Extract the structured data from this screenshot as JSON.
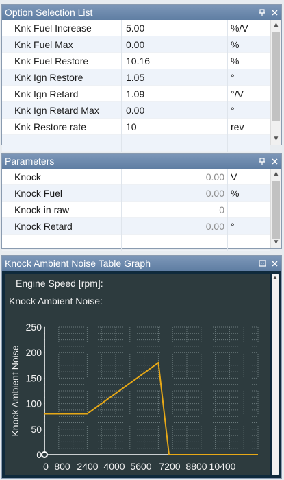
{
  "option_panel": {
    "title": "Option Selection List",
    "rows": [
      {
        "name": "Knk Fuel Increase",
        "value": "5.00",
        "unit": "%/V"
      },
      {
        "name": "Knk Fuel Max",
        "value": "0.00",
        "unit": "%"
      },
      {
        "name": "Knk Fuel Restore",
        "value": "10.16",
        "unit": "%"
      },
      {
        "name": "Knk Ign Restore",
        "value": "1.05",
        "unit": "°"
      },
      {
        "name": "Knk Ign Retard",
        "value": "1.09",
        "unit": "°/V"
      },
      {
        "name": "Knk Ign Retard Max",
        "value": "0.00",
        "unit": "°"
      },
      {
        "name": "Knk Restore rate",
        "value": "10",
        "unit": "rev"
      }
    ]
  },
  "params_panel": {
    "title": "Parameters",
    "rows": [
      {
        "name": "Knock",
        "value": "0.00",
        "unit": "V"
      },
      {
        "name": "Knock Fuel",
        "value": "0.00",
        "unit": "%"
      },
      {
        "name": "Knock in raw",
        "value": "0",
        "unit": ""
      },
      {
        "name": "Knock Retard",
        "value": "0.00",
        "unit": "°"
      }
    ]
  },
  "graph_panel": {
    "title": "Knock Ambient Noise Table Graph",
    "engine_speed_label": "Engine Speed [rpm]:",
    "noise_label": "Knock Ambient Noise:"
  },
  "icons": {
    "pin": "pin-icon",
    "close": "close-icon",
    "maximize": "maximize-icon"
  },
  "colors": {
    "title_bar": "#6f8db2",
    "graph_bg": "#2d3b3e",
    "line": "#e6a817",
    "grid": "#6b7a7c"
  },
  "chart_data": {
    "type": "line",
    "xlabel": "Engine Speed [rpm]",
    "ylabel": "Knock Ambient Noise",
    "xlim": [
      0,
      12000
    ],
    "ylim": [
      0,
      250
    ],
    "x_ticks": [
      "0",
      "800",
      "2400",
      "4000",
      "5600",
      "7200",
      "8800",
      "10400"
    ],
    "y_ticks": [
      "0",
      "50",
      "100",
      "150",
      "200",
      "250"
    ],
    "grid": true,
    "series": [
      {
        "x": [
          0,
          2400,
          6400,
          7000,
          12000
        ],
        "y": [
          80,
          80,
          180,
          0,
          0
        ]
      }
    ]
  }
}
